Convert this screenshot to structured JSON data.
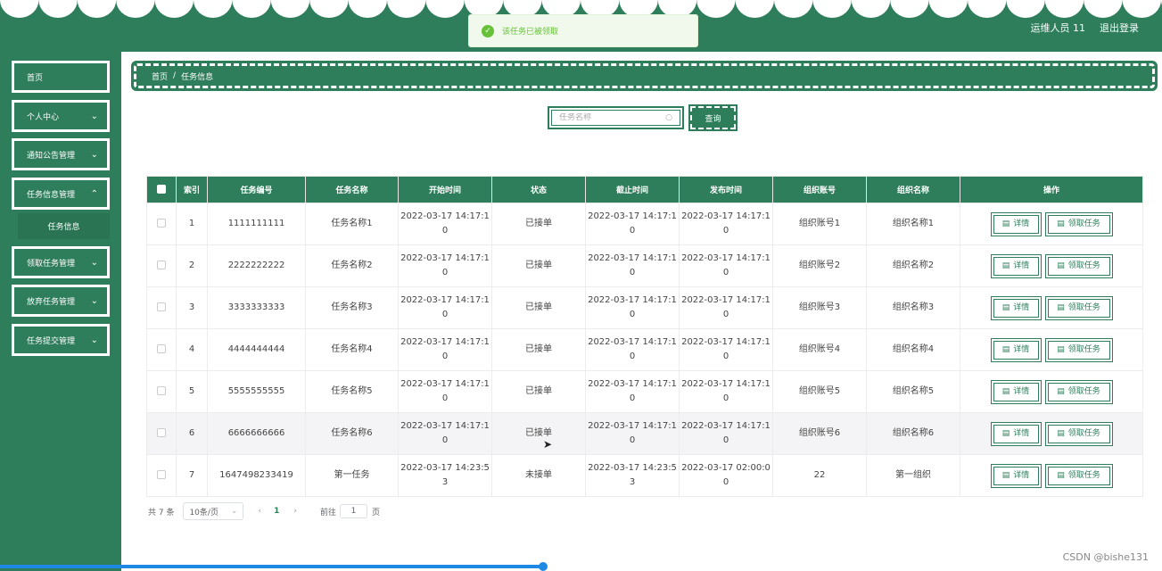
{
  "colors": {
    "primary": "#2e7d5b",
    "success": "#67c23a",
    "progress": "#1e88e5"
  },
  "header": {
    "user": "运维人员 11",
    "logout": "退出登录"
  },
  "toast": {
    "icon": "check-circle-icon",
    "text": "该任务已被领取"
  },
  "sidebar": {
    "items": [
      {
        "label": "首页",
        "has_children": false
      },
      {
        "label": "个人中心",
        "has_children": true
      },
      {
        "label": "通知公告管理",
        "has_children": true
      },
      {
        "label": "任务信息管理",
        "has_children": true,
        "expanded": true
      },
      {
        "label": "领取任务管理",
        "has_children": true
      },
      {
        "label": "放弃任务管理",
        "has_children": true
      },
      {
        "label": "任务提交管理",
        "has_children": true
      }
    ],
    "subitem": "任务信息"
  },
  "breadcrumb": {
    "home": "首页",
    "sep": "/",
    "current": "任务信息"
  },
  "search": {
    "placeholder": "任务名称",
    "button": "查询"
  },
  "table": {
    "columns": [
      "索引",
      "任务编号",
      "任务名称",
      "开始时间",
      "状态",
      "截止时间",
      "发布时间",
      "组织账号",
      "组织名称",
      "操作"
    ],
    "detail_label": "详情",
    "claim_label": "领取任务",
    "rows": [
      {
        "index": "1",
        "code": "1111111111",
        "name": "任务名称1",
        "start_a": "2022-03-17 14:17:1",
        "start_b": "0",
        "status": "已接单",
        "end_a": "2022-03-17 14:17:1",
        "end_b": "0",
        "pub_a": "2022-03-17 14:17:1",
        "pub_b": "0",
        "org_account": "组织账号1",
        "org_name": "组织名称1"
      },
      {
        "index": "2",
        "code": "2222222222",
        "name": "任务名称2",
        "start_a": "2022-03-17 14:17:1",
        "start_b": "0",
        "status": "已接单",
        "end_a": "2022-03-17 14:17:1",
        "end_b": "0",
        "pub_a": "2022-03-17 14:17:1",
        "pub_b": "0",
        "org_account": "组织账号2",
        "org_name": "组织名称2"
      },
      {
        "index": "3",
        "code": "3333333333",
        "name": "任务名称3",
        "start_a": "2022-03-17 14:17:1",
        "start_b": "0",
        "status": "已接单",
        "end_a": "2022-03-17 14:17:1",
        "end_b": "0",
        "pub_a": "2022-03-17 14:17:1",
        "pub_b": "0",
        "org_account": "组织账号3",
        "org_name": "组织名称3"
      },
      {
        "index": "4",
        "code": "4444444444",
        "name": "任务名称4",
        "start_a": "2022-03-17 14:17:1",
        "start_b": "0",
        "status": "已接单",
        "end_a": "2022-03-17 14:17:1",
        "end_b": "0",
        "pub_a": "2022-03-17 14:17:1",
        "pub_b": "0",
        "org_account": "组织账号4",
        "org_name": "组织名称4"
      },
      {
        "index": "5",
        "code": "5555555555",
        "name": "任务名称5",
        "start_a": "2022-03-17 14:17:1",
        "start_b": "0",
        "status": "已接单",
        "end_a": "2022-03-17 14:17:1",
        "end_b": "0",
        "pub_a": "2022-03-17 14:17:1",
        "pub_b": "0",
        "org_account": "组织账号5",
        "org_name": "组织名称5"
      },
      {
        "index": "6",
        "code": "6666666666",
        "name": "任务名称6",
        "start_a": "2022-03-17 14:17:1",
        "start_b": "0",
        "status": "已接单",
        "end_a": "2022-03-17 14:17:1",
        "end_b": "0",
        "pub_a": "2022-03-17 14:17:1",
        "pub_b": "0",
        "org_account": "组织账号6",
        "org_name": "组织名称6"
      },
      {
        "index": "7",
        "code": "1647498233419",
        "name": "第一任务",
        "start_a": "2022-03-17 14:23:5",
        "start_b": "3",
        "status": "未接单",
        "end_a": "2022-03-17 14:23:5",
        "end_b": "3",
        "pub_a": "2022-03-17 02:00:0",
        "pub_b": "0",
        "org_account": "22",
        "org_name": "第一组织"
      }
    ]
  },
  "pager": {
    "total": "共 7 条",
    "page_size": "10条/页",
    "current_page": "1",
    "goto_prefix": "前往",
    "goto_value": "1",
    "goto_suffix": "页"
  },
  "watermark": "CSDN @bishe131"
}
